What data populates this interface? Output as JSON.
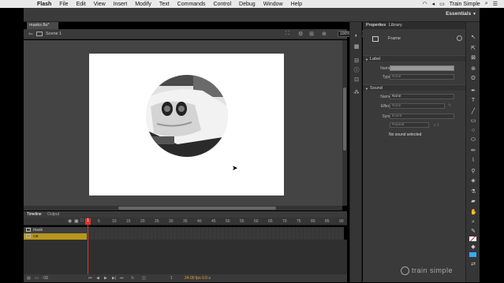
{
  "menubar": {
    "app": "Flash",
    "items": [
      "File",
      "Edit",
      "View",
      "Insert",
      "Modify",
      "Text",
      "Commands",
      "Control",
      "Debug",
      "Window",
      "Help"
    ],
    "user": "Train Simple"
  },
  "toolbar": {
    "workspace": "Essentials"
  },
  "document": {
    "tab_label": "masks.fla*",
    "scene": "Scene 1",
    "zoom": "100%"
  },
  "timeline": {
    "tabs": [
      "Timeline",
      "Output"
    ],
    "ruler": [
      "1",
      "5",
      "10",
      "15",
      "20",
      "25",
      "30",
      "35",
      "40",
      "45",
      "50",
      "55",
      "60",
      "65",
      "70",
      "75",
      "80",
      "85",
      "90"
    ],
    "layers": [
      {
        "name": "mask"
      },
      {
        "name": "car"
      }
    ],
    "current_frame": "1",
    "fps": "24.00 fps",
    "time": "0.0 s"
  },
  "properties": {
    "tabs": [
      "Properties",
      "Library"
    ],
    "type_label": "Frame",
    "sections": {
      "label": {
        "title": "Label",
        "name_label": "Name:",
        "type_label": "Type:",
        "type_value": "None"
      },
      "sound": {
        "title": "Sound",
        "name_label": "Name:",
        "name_value": "None",
        "effect_label": "Effect:",
        "effect_value": "None",
        "sync_label": "Sync:",
        "sync_value": "Event",
        "repeat_value": "Repeat",
        "repeat_count": "x 1",
        "status": "No sound selected"
      }
    }
  },
  "watermark": "train simple",
  "colors": {
    "layer_highlight": "#b8961d",
    "playhead": "#dd3333",
    "stage": "#ffffff"
  }
}
